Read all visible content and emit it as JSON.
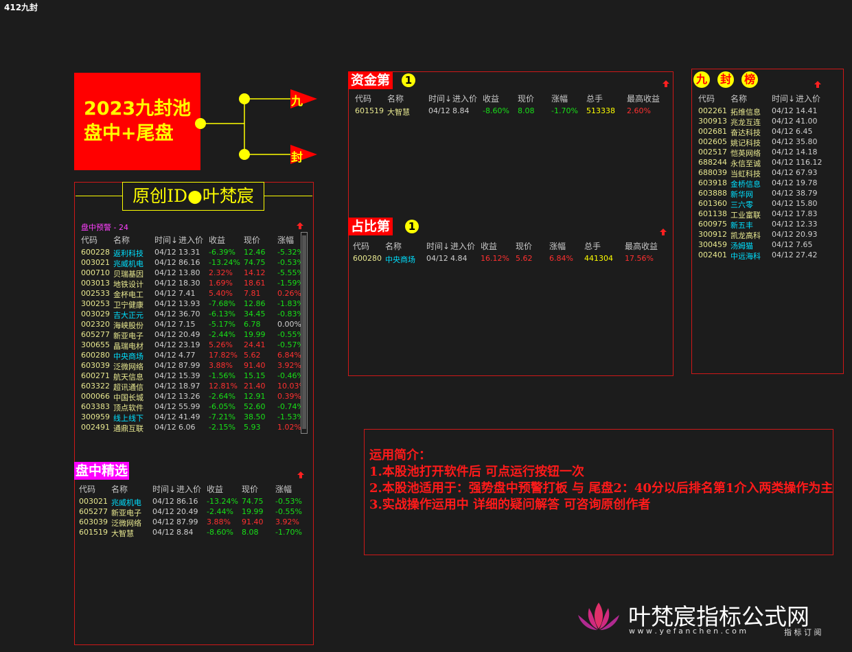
{
  "window_title": "412九封",
  "logo_block": {
    "line1": "2023九封池",
    "line2": "盘中+尾盘"
  },
  "flow": {
    "branch_top": "九",
    "branch_bottom": "封"
  },
  "author_banner": "原创ID●叶梵宸",
  "alert_panel": {
    "title": "盘中预警 - 24",
    "headers": [
      "代码",
      "名称",
      "时间↓",
      "进入价",
      "收益",
      "现价",
      "涨幅"
    ],
    "rows": [
      [
        "600228",
        "返利科技",
        "04/12",
        "13.31",
        "-6.39%",
        "12.46",
        "-5.32%"
      ],
      [
        "003021",
        "兆威机电",
        "04/12",
        "86.16",
        "-13.24%",
        "74.75",
        "-0.53%"
      ],
      [
        "000710",
        "贝瑞基因",
        "04/12",
        "13.80",
        "2.32%",
        "14.12",
        "-5.55%"
      ],
      [
        "003013",
        "地铁设计",
        "04/12",
        "18.30",
        "1.69%",
        "18.61",
        "-1.59%"
      ],
      [
        "002533",
        "金杯电工",
        "04/12",
        "7.41",
        "5.40%",
        "7.81",
        "0.26%"
      ],
      [
        "300253",
        "卫宁健康",
        "04/12",
        "13.93",
        "-7.68%",
        "12.86",
        "-1.83%"
      ],
      [
        "003029",
        "吉大正元",
        "04/12",
        "36.70",
        "-6.13%",
        "34.45",
        "-0.83%"
      ],
      [
        "002320",
        "海峡股份",
        "04/12",
        "7.15",
        "-5.17%",
        "6.78",
        "0.00%"
      ],
      [
        "605277",
        "新亚电子",
        "04/12",
        "20.49",
        "-2.44%",
        "19.99",
        "-0.55%"
      ],
      [
        "300655",
        "晶瑞电材",
        "04/12",
        "23.19",
        "5.26%",
        "24.41",
        "-0.57%"
      ],
      [
        "600280",
        "中央商场",
        "04/12",
        "4.77",
        "17.82%",
        "5.62",
        "6.84%"
      ],
      [
        "603039",
        "泛微网络",
        "04/12",
        "87.99",
        "3.88%",
        "91.40",
        "3.92%"
      ],
      [
        "600271",
        "航天信息",
        "04/12",
        "15.39",
        "-1.56%",
        "15.15",
        "-0.46%"
      ],
      [
        "603322",
        "超讯通信",
        "04/12",
        "18.97",
        "12.81%",
        "21.40",
        "10.03%"
      ],
      [
        "000066",
        "中国长城",
        "04/12",
        "13.26",
        "-2.64%",
        "12.91",
        "0.39%"
      ],
      [
        "603383",
        "顶点软件",
        "04/12",
        "55.99",
        "-6.05%",
        "52.60",
        "-0.74%"
      ],
      [
        "300959",
        "线上线下",
        "04/12",
        "41.49",
        "-7.21%",
        "38.50",
        "-1.53%"
      ],
      [
        "002491",
        "通鼎互联",
        "04/12",
        "6.06",
        "-2.15%",
        "5.93",
        "1.02%"
      ]
    ]
  },
  "select_panel": {
    "title": "盘中精选",
    "headers": [
      "代码",
      "名称",
      "时间↓",
      "进入价",
      "收益",
      "现价",
      "涨幅"
    ],
    "rows": [
      [
        "003021",
        "兆威机电",
        "04/12",
        "86.16",
        "-13.24%",
        "74.75",
        "-0.53%"
      ],
      [
        "605277",
        "新亚电子",
        "04/12",
        "20.49",
        "-2.44%",
        "19.99",
        "-0.55%"
      ],
      [
        "603039",
        "泛微网络",
        "04/12",
        "87.99",
        "3.88%",
        "91.40",
        "3.92%"
      ],
      [
        "601519",
        "大智慧",
        "04/12",
        "8.84",
        "-8.60%",
        "8.08",
        "-1.70%"
      ]
    ]
  },
  "fund_panel": {
    "title": "资金第",
    "badge": "1",
    "headers": [
      "代码",
      "名称",
      "时间↓",
      "进入价",
      "收益",
      "现价",
      "涨幅",
      "总手",
      "最高收益"
    ],
    "rows": [
      [
        "601519",
        "大智慧",
        "04/12",
        "8.84",
        "-8.60%",
        "8.08",
        "-1.70%",
        "513338",
        "2.60%"
      ]
    ]
  },
  "ratio_panel": {
    "title": "占比第",
    "badge": "1",
    "headers": [
      "代码",
      "名称",
      "时间↓",
      "进入价",
      "收益",
      "现价",
      "涨幅",
      "总手",
      "最高收益"
    ],
    "rows": [
      [
        "600280",
        "中央商场",
        "04/12",
        "4.84",
        "16.12%",
        "5.62",
        "6.84%",
        "441304",
        "17.56%"
      ]
    ]
  },
  "rank_panel": {
    "title_chars": [
      "九",
      "封",
      "榜"
    ],
    "headers": [
      "代码",
      "名称",
      "时间↓",
      "进入价"
    ],
    "rows": [
      [
        "002261",
        "拓维信息",
        "04/12",
        "14.41"
      ],
      [
        "300913",
        "兆龙互连",
        "04/12",
        "41.00"
      ],
      [
        "002681",
        "奋达科技",
        "04/12",
        "6.45"
      ],
      [
        "002605",
        "姚记科技",
        "04/12",
        "35.80"
      ],
      [
        "002517",
        "恺英网络",
        "04/12",
        "14.18"
      ],
      [
        "688244",
        "永信至诚",
        "04/12",
        "116.12"
      ],
      [
        "688039",
        "当虹科技",
        "04/12",
        "67.93"
      ],
      [
        "603918",
        "金桥信息",
        "04/12",
        "19.78"
      ],
      [
        "603888",
        "新华网",
        "04/12",
        "38.79"
      ],
      [
        "601360",
        "三六零",
        "04/12",
        "15.80"
      ],
      [
        "601138",
        "工业富联",
        "04/12",
        "17.83"
      ],
      [
        "600975",
        "新五丰",
        "04/12",
        "12.33"
      ],
      [
        "300912",
        "凯龙高科",
        "04/12",
        "20.93"
      ],
      [
        "300459",
        "汤姆猫",
        "04/12",
        "7.65"
      ],
      [
        "002401",
        "中远海科",
        "04/12",
        "27.42"
      ]
    ]
  },
  "intro": {
    "lines": [
      "运用简介：",
      "1.本股池打开软件后 可点运行按钮一次",
      "2.本股池适用于：强势盘中预警打板 与 尾盘2：40分以后排名第1介入两类操作为主",
      "3.实战操作运用中 详细的疑问解答 可咨询原创作者"
    ]
  },
  "watermark": {
    "title": "叶梵宸指标公式网",
    "url": "w w w . y e f a n c h e n . c o m",
    "tag": "指 标 订 阅"
  }
}
